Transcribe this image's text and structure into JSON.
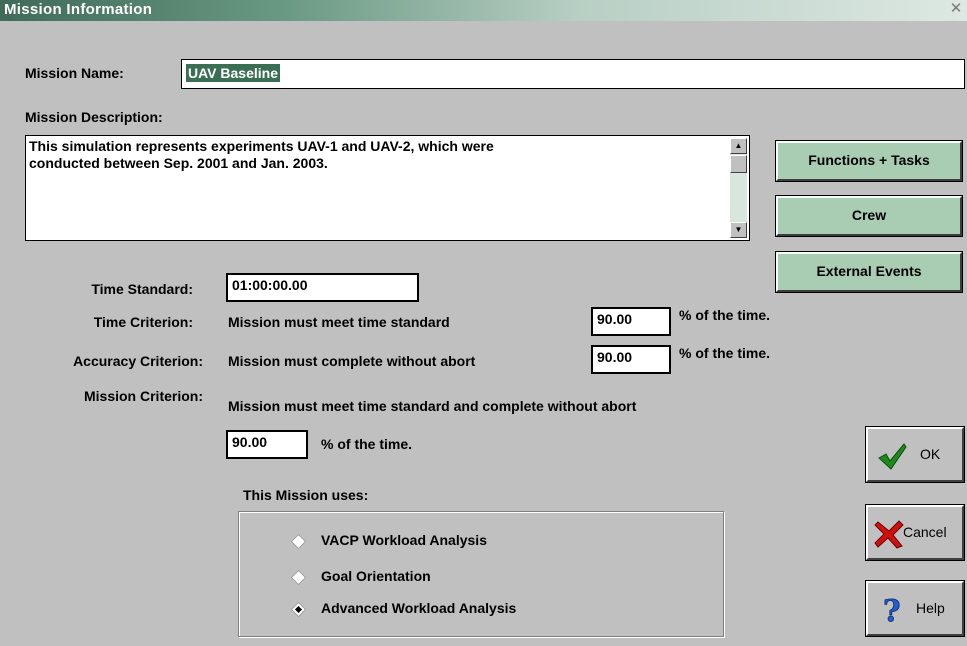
{
  "window": {
    "title": "Mission Information",
    "close_icon": "close-icon"
  },
  "mission_name": {
    "label": "Mission Name:",
    "value": "UAV Baseline"
  },
  "mission_description": {
    "label": "Mission Description:",
    "line1": "This simulation represents experiments UAV-1 and UAV-2, which were",
    "line2": "conducted between Sep. 2001 and Jan. 2003."
  },
  "buttons": {
    "functions_tasks": "Functions + Tasks",
    "crew": "Crew",
    "external_events": "External Events",
    "ok": "OK",
    "cancel": "Cancel",
    "help": "Help"
  },
  "time_standard": {
    "label": "Time Standard:",
    "value": "01:00:00.00"
  },
  "time_criterion": {
    "label": "Time Criterion:",
    "text": "Mission must meet time standard",
    "value": "90.00",
    "suffix": "% of the time."
  },
  "accuracy_criterion": {
    "label": "Accuracy Criterion:",
    "text": "Mission must complete without abort",
    "value": "90.00",
    "suffix": "% of the time."
  },
  "mission_criterion": {
    "label": "Mission Criterion:",
    "text": "Mission must meet time standard and complete without abort",
    "value": "90.00",
    "suffix": "% of the time."
  },
  "uses": {
    "label": "This Mission uses:",
    "options": [
      {
        "label": "VACP Workload Analysis",
        "selected": false
      },
      {
        "label": "Goal Orientation",
        "selected": false
      },
      {
        "label": "Advanced Workload Analysis",
        "selected": true
      }
    ]
  },
  "colors": {
    "button_green": "#a9cdb2",
    "title_green": "#3f6b58",
    "selection_green": "#3b6f55"
  }
}
